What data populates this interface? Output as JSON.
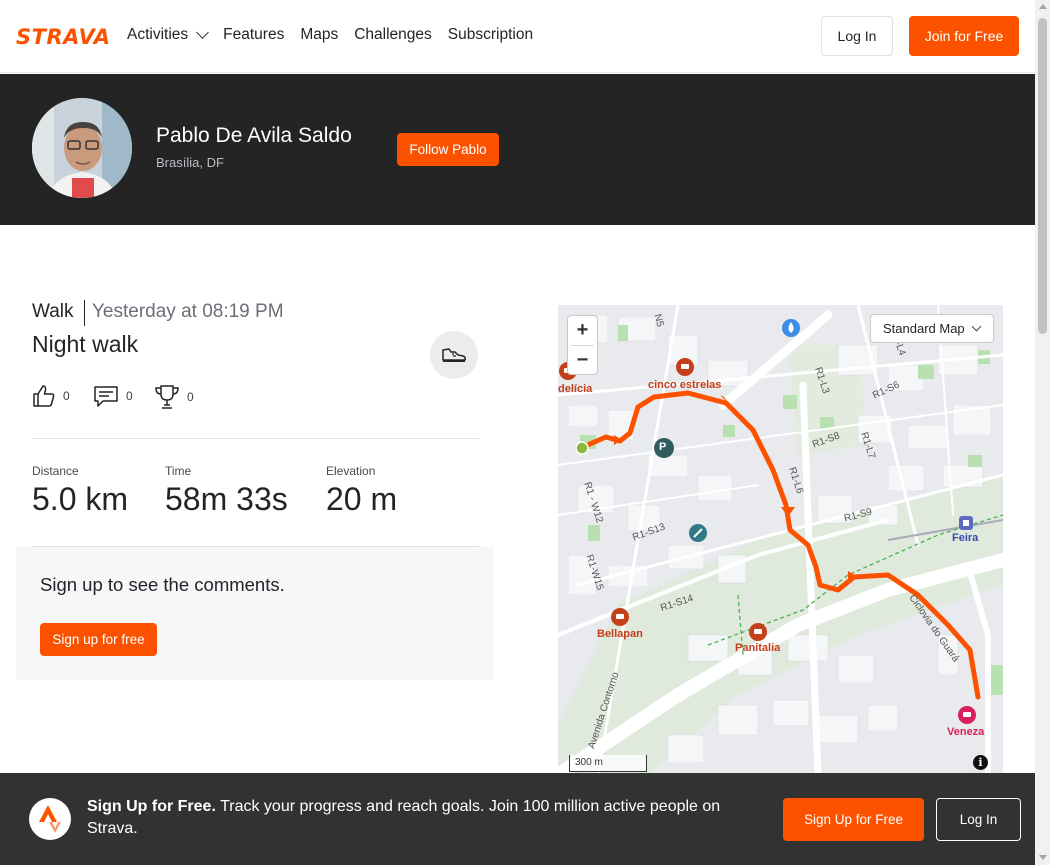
{
  "brand": {
    "name": "STRAVA",
    "accent": "#fc5200"
  },
  "nav": {
    "items": [
      {
        "label": "Activities",
        "has_dropdown": true
      },
      {
        "label": "Features"
      },
      {
        "label": "Maps"
      },
      {
        "label": "Challenges"
      },
      {
        "label": "Subscription"
      }
    ],
    "login_label": "Log In",
    "join_label": "Join for Free"
  },
  "athlete": {
    "name": "Pablo De Avila Saldo",
    "location": "Brasília, DF",
    "follow_label": "Follow Pablo"
  },
  "activity": {
    "type": "Walk",
    "datetime": "Yesterday at 08:19 PM",
    "title": "Night walk",
    "gear_icon": "shoe-icon",
    "kudos_count": "0",
    "comments_count": "0",
    "achievements_count": "0",
    "stats": [
      {
        "label": "Distance",
        "value": "5.0 km"
      },
      {
        "label": "Time",
        "value": "58m 33s"
      },
      {
        "label": "Elevation",
        "value": "20 m"
      }
    ]
  },
  "comments": {
    "title": "Sign up to see the comments.",
    "signup_label": "Sign up for free"
  },
  "map": {
    "zoom_in": "+",
    "zoom_out": "−",
    "map_type": "Standard Map",
    "scale": "300 m",
    "info": "i",
    "route_color": "#fc5200",
    "labels": {
      "delicia": "delícia",
      "cinco": "cinco estrelas",
      "bellapan": "Bellapan",
      "panitalia": "Panitalia",
      "feira": "Feira",
      "veneza": "Veneza",
      "n5": "N5",
      "l4": "R1-L4",
      "l3": "R1-L3",
      "s6": "R1-S6",
      "s8": "R1-S8",
      "l7": "R1-L7",
      "l6": "R1-L6",
      "w12": "R1 - W12",
      "s13": "R1-S13",
      "s9": "R1-S9",
      "w15": "R1-W15",
      "s14": "R1-S14",
      "ciclovia": "Ciclovia do Guará",
      "avenida": "Avenida Contorno",
      "parking": "P"
    }
  },
  "banner": {
    "bold": "Sign Up for Free.",
    "text": " Track your progress and reach goals. Join 100 million active people on Strava.",
    "signup_label": "Sign Up for Free",
    "login_label": "Log In"
  }
}
